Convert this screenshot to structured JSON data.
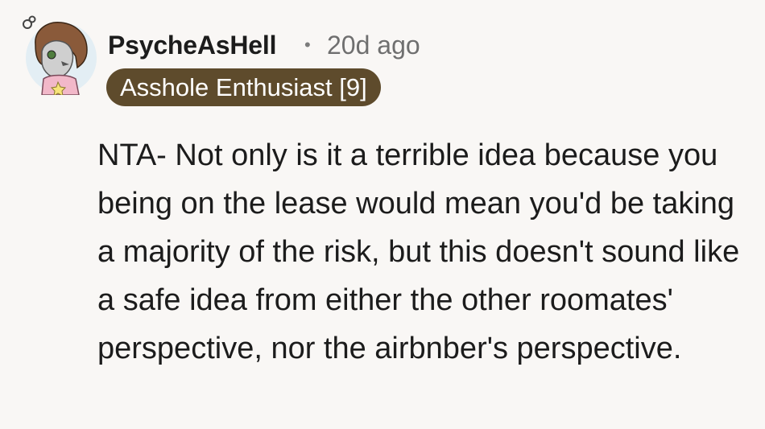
{
  "comment": {
    "avatar": {
      "icon": "avatar-icon"
    },
    "username": "PsycheAsHell",
    "separator": "•",
    "timestamp": "20d ago",
    "flair": {
      "text": "Asshole Enthusiast [9]",
      "background_color": "#5e4b2c",
      "text_color": "#ffffff"
    },
    "body": "NTA- Not only is it a terrible idea because you being on the lease would mean you'd be taking a majority of the risk, but this doesn't sound like a safe idea from either the other roomates' perspective, nor the airbnber's perspective."
  }
}
